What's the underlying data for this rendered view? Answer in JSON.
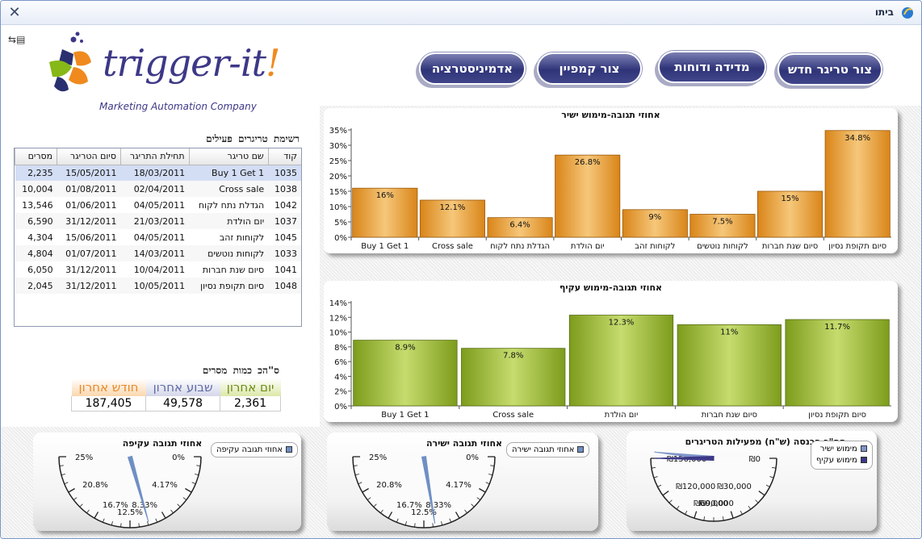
{
  "window": {
    "title": "ביתו"
  },
  "toolbar": {
    "buttons": [
      {
        "label": "צור טריגר חדש"
      },
      {
        "label": "מדידה ודוחות"
      },
      {
        "label": "צור קמפיין"
      },
      {
        "label": "אדמיניסטרציה"
      }
    ]
  },
  "logo": {
    "name_main": "trigger-it",
    "name_bang": "!",
    "tagline": "Marketing Automation Company"
  },
  "triggers": {
    "title": "רשימת טריגרים פעילים",
    "columns": [
      "קוד",
      "שם טריגר",
      "תחילת התריגר",
      "סיום הטריגר",
      "מסרים"
    ],
    "rows": [
      [
        "1035",
        "Buy 1 Get 1",
        "18/03/2011",
        "15/05/2011",
        "2,235"
      ],
      [
        "1038",
        "Cross sale",
        "02/04/2011",
        "01/08/2011",
        "10,004"
      ],
      [
        "1042",
        "הגדלת נתח לקוח",
        "04/05/2011",
        "01/06/2011",
        "13,546"
      ],
      [
        "1037",
        "יום הולדת",
        "21/03/2011",
        "31/12/2011",
        "6,590"
      ],
      [
        "1045",
        "לקוחות זהב",
        "04/05/2011",
        "15/06/2011",
        "4,304"
      ],
      [
        "1033",
        "לקוחות נוטשים",
        "14/03/2011",
        "01/07/2011",
        "4,804"
      ],
      [
        "1041",
        "סיום שנת חברות",
        "10/04/2011",
        "31/12/2011",
        "6,050"
      ],
      [
        "1048",
        "סיום תקופת נסיון",
        "10/05/2011",
        "31/12/2011",
        "2,045"
      ]
    ]
  },
  "totals": {
    "title": "ס\"הכ כמות מסרים",
    "headers": [
      "יום אחרון",
      "שבוע אחרון",
      "חודש אחרון"
    ],
    "values": [
      "2,361",
      "49,578",
      "187,405"
    ],
    "colors": [
      "#6d8a1a",
      "#5f6aa3",
      "#e7892a"
    ]
  },
  "chart_data": [
    {
      "type": "bar",
      "title": "אחוזי תגובה-מימוש ישיר",
      "categories": [
        "Buy 1 Get 1",
        "Cross sale",
        "הגדלת נתח לקוח",
        "יום הולדת",
        "לקוחות זהב",
        "לקוחות נוטשים",
        "סיום שנת חברות",
        "סיום תקופת נסיון"
      ],
      "values": [
        16,
        12.1,
        6.4,
        26.8,
        9,
        7.5,
        15,
        34.8
      ],
      "labels": [
        "16%",
        "12.1%",
        "6.4%",
        "26.8%",
        "9%",
        "7.5%",
        "15%",
        "34.8%"
      ],
      "yticks": [
        "0%",
        "5%",
        "10%",
        "15%",
        "20%",
        "25%",
        "30%",
        "35%"
      ],
      "ylim": [
        0,
        35
      ],
      "color": "#d98519"
    },
    {
      "type": "bar",
      "title": "אחוזי תגובה-מימוש עקיף",
      "categories": [
        "Buy 1 Get 1",
        "Cross sale",
        "יום הולדת",
        "סיום שנת חברות",
        "סיום תקופת נסיון"
      ],
      "values": [
        8.9,
        7.8,
        12.3,
        11,
        11.7
      ],
      "labels": [
        "8.9%",
        "7.8%",
        "12.3%",
        "11%",
        "11.7%"
      ],
      "yticks": [
        "0%",
        "2%",
        "4%",
        "6%",
        "8%",
        "10%",
        "12%",
        "14%"
      ],
      "ylim": [
        0,
        14
      ],
      "color": "#7d9c1c"
    },
    {
      "type": "gauge",
      "title": "אחוזי תגובה עקיפה",
      "legend": [
        "אחוזי תגובה עקיפה"
      ],
      "ticks": [
        "0%",
        "4.17%",
        "8.33%",
        "12.5%",
        "16.7%",
        "20.8%",
        "25%"
      ],
      "range": [
        0,
        25
      ],
      "value": 10.3,
      "color": "#6f8fc4"
    },
    {
      "type": "gauge",
      "title": "אחוזי תגובה ישירה",
      "legend": [
        "אחוזי תגובה ישירה"
      ],
      "ticks": [
        "0%",
        "4.17%",
        "8.33%",
        "12.5%",
        "16.7%",
        "20.8%",
        "25%"
      ],
      "range": [
        0,
        25
      ],
      "value": 11.2,
      "color": "#6f8fc4"
    },
    {
      "type": "gauge",
      "title": "סה\"כ הכנסה (ש\"ח) מפעילות הטריגרים",
      "legend": [
        "מימוש ישיר",
        "מימוש עקיף"
      ],
      "ticks": [
        "₪0",
        "₪30,000",
        "₪60,000",
        "₪90,000",
        "₪120,000",
        "₪150,000"
      ],
      "range": [
        0,
        150000
      ],
      "values": [
        155000,
        150000
      ],
      "colors": [
        "#7e95c9",
        "#3d3887"
      ]
    }
  ]
}
